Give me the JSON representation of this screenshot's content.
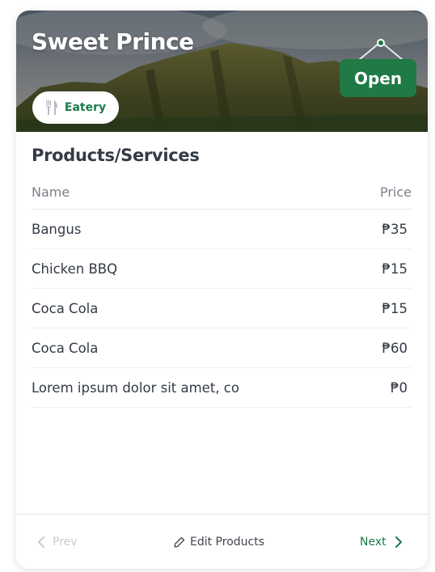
{
  "store": {
    "name": "Sweet Prince",
    "category": "Eatery",
    "category_icon": "fork-knife-icon",
    "status": "Open"
  },
  "products": {
    "title": "Products/Services",
    "columns": {
      "name": "Name",
      "price": "Price"
    },
    "items": [
      {
        "name": "Bangus",
        "price": "₱35"
      },
      {
        "name": "Chicken BBQ",
        "price": "₱15"
      },
      {
        "name": "Coca Cola",
        "price": "₱15"
      },
      {
        "name": "Coca Cola",
        "price": "₱60"
      },
      {
        "name": "Lorem ipsum dolor sit amet, co",
        "price": "₱0"
      }
    ]
  },
  "footer": {
    "prev_label": "Prev",
    "edit_label": "Edit Products",
    "next_label": "Next"
  },
  "colors": {
    "brand_green": "#1f7a45",
    "text_dark": "#343a46",
    "text_muted": "#7a7f88",
    "disabled": "#c7cbd1"
  }
}
